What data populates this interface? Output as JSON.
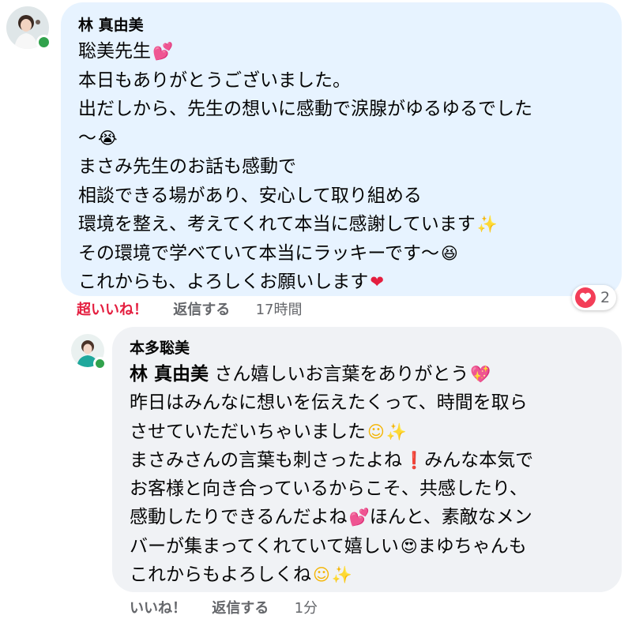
{
  "comment": {
    "author": "林 真由美",
    "lines": [
      "聡美先生",
      "本日もありがとうございました。",
      "出だしから、先生の想いに感動で涙腺がゆるゆるでした",
      "〜",
      "まさみ先生のお話も感動で",
      "相談できる場があり、安心して取り組める",
      "環境を整え、考えてくれて本当に感謝しています",
      "その環境で学べていて本当にラッキーです〜",
      "これからも、よろしくお願いします"
    ],
    "actions": {
      "like": "超いいね！",
      "reply": "返信する",
      "time": "17時間"
    },
    "reaction_count": "2"
  },
  "reply": {
    "author": "本多聡美",
    "mention": "林 真由美",
    "lines": [
      " さん嬉しいお言葉をありがとう",
      "昨日はみんなに想いを伝えたくって、時間を取ら",
      "させていただいちゃいました",
      "まさみさんの言葉も刺さったよね",
      "みんな本気で",
      "お客様と向き合っているからこそ、共感したり、",
      "感動したりできるんだよね",
      "ほんと、素敵なメン",
      "バーが集まってくれていて嬉しい",
      "まゆちゃんも",
      "これからもよろしくね"
    ],
    "actions": {
      "like": "いいね！",
      "reply": "返信する",
      "time": "1分"
    }
  },
  "icons": {
    "sparkling-heart": "💖",
    "heart": "❤",
    "sparkles": "✨",
    "crying-face": "😭",
    "grinning-squint": "😆",
    "smiling-face": "☺",
    "exclamation": "❗",
    "heart-eyes": "😍",
    "two-hearts": "💕"
  },
  "colors": {
    "bubble_self": "#e7f3ff",
    "bubble_other": "#f0f2f5",
    "like_active": "#e41e3f",
    "online": "#31a24c"
  }
}
